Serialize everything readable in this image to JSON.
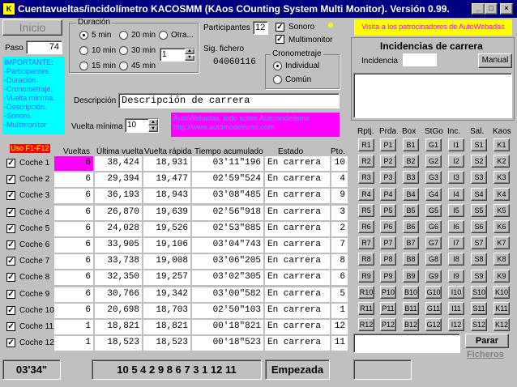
{
  "window": {
    "title": "Cuentavueltas/incidolímetro KACOSMM (KAos COunting System Multi Monitor). Versión 0.99.",
    "icon_label": "K"
  },
  "controls": {
    "minimize": "_",
    "maximize": "□",
    "close": "×"
  },
  "left": {
    "inicio": "Inicio",
    "paso_label": "Paso",
    "paso_value": "74",
    "important_text": "IMPORTANTE:\n-Participantes.\n-Duración.\n-Cronometraje.\n-Vuelta mínima.\n-Descripción.\n-Sonoro.\n-Multimonitor"
  },
  "duracion": {
    "title": "Duración",
    "options": [
      "5 min",
      "10 min",
      "15 min",
      "20 min",
      "30 min",
      "45 min",
      "Otra..."
    ],
    "selected": "5 min",
    "otra_value": "1"
  },
  "participantes": {
    "label": "Participantes",
    "value": "12"
  },
  "sig_fichero": {
    "label": "Sig. fichero",
    "value": "04060116"
  },
  "sonoro": {
    "label": "Sonoro",
    "checked": true
  },
  "multimonitor": {
    "label": "Multimonitor",
    "checked": true
  },
  "cronometraje": {
    "title": "Cronometraje",
    "options": [
      "Individual",
      "Común"
    ],
    "selected": "Individual"
  },
  "descripcion": {
    "label": "Descripción",
    "value": "Descripción de carrera"
  },
  "vuelta_minima": {
    "label": "Vuelta mínima",
    "value": "10"
  },
  "ad": {
    "text": "AutoWebadas, todo sobre Automodelismo\nhttp://www.automodelismo.com",
    "sponsor_text": "Visita a los patrocinadores de AutoWebadas"
  },
  "table": {
    "uso_label": "Uso F1-F12",
    "headers": [
      "Vueltas",
      "Última vuelta",
      "Vuelta rápida",
      "Tiempo acumulado",
      "Estado",
      "Pto."
    ],
    "rows": [
      {
        "name": "Coche 1",
        "vueltas": "6",
        "ultima": "38,424",
        "rapida": "18,931",
        "tiempo": "03'11\"196",
        "estado": "En carrera",
        "pto": "10",
        "highlight": true
      },
      {
        "name": "Coche 2",
        "vueltas": "6",
        "ultima": "29,394",
        "rapida": "19,477",
        "tiempo": "02'59\"524",
        "estado": "En carrera",
        "pto": "4",
        "highlight": false
      },
      {
        "name": "Coche 3",
        "vueltas": "6",
        "ultima": "36,193",
        "rapida": "18,943",
        "tiempo": "03'08\"485",
        "estado": "En carrera",
        "pto": "9",
        "highlight": false
      },
      {
        "name": "Coche 4",
        "vueltas": "6",
        "ultima": "26,870",
        "rapida": "19,639",
        "tiempo": "02'56\"918",
        "estado": "En carrera",
        "pto": "3",
        "highlight": false
      },
      {
        "name": "Coche 5",
        "vueltas": "6",
        "ultima": "24,028",
        "rapida": "19,526",
        "tiempo": "02'53\"885",
        "estado": "En carrera",
        "pto": "2",
        "highlight": false
      },
      {
        "name": "Coche 6",
        "vueltas": "6",
        "ultima": "33,905",
        "rapida": "19,106",
        "tiempo": "03'04\"743",
        "estado": "En carrera",
        "pto": "7",
        "highlight": false
      },
      {
        "name": "Coche 7",
        "vueltas": "6",
        "ultima": "33,738",
        "rapida": "19,008",
        "tiempo": "03'06\"205",
        "estado": "En carrera",
        "pto": "8",
        "highlight": false
      },
      {
        "name": "Coche 8",
        "vueltas": "6",
        "ultima": "32,350",
        "rapida": "19,257",
        "tiempo": "03'02\"305",
        "estado": "En carrera",
        "pto": "6",
        "highlight": false
      },
      {
        "name": "Coche 9",
        "vueltas": "6",
        "ultima": "30,766",
        "rapida": "19,342",
        "tiempo": "03'00\"582",
        "estado": "En carrera",
        "pto": "5",
        "highlight": false
      },
      {
        "name": "Coche 10",
        "vueltas": "6",
        "ultima": "20,698",
        "rapida": "18,703",
        "tiempo": "02'50\"103",
        "estado": "En carrera",
        "pto": "1",
        "highlight": false
      },
      {
        "name": "Coche 11",
        "vueltas": "1",
        "ultima": "18,821",
        "rapida": "18,821",
        "tiempo": "00'18\"821",
        "estado": "En carrera",
        "pto": "12",
        "highlight": false
      },
      {
        "name": "Coche 12",
        "vueltas": "1",
        "ultima": "18,523",
        "rapida": "18,523",
        "tiempo": "00'18\"523",
        "estado": "En carrera",
        "pto": "11",
        "highlight": false
      }
    ]
  },
  "footer": {
    "elapsed": "03'34\"",
    "order": "10 5 4 2 9 8 6 7 3 1 12 11",
    "status": "Empezada"
  },
  "right": {
    "incidencias_title": "Incidencias de carrera",
    "incidencia_label": "Incidencia",
    "manual": "Manual",
    "grid_headers": [
      "Rptj.",
      "Prda.",
      "Box",
      "StGo",
      "Inc.",
      "Sal.",
      "Kaos"
    ],
    "grid_prefixes": [
      "R",
      "P",
      "B",
      "G",
      "I",
      "S",
      "K"
    ],
    "parar": "Parar",
    "ficheros": "Ficheros"
  },
  "colors": {
    "highlight": "#ff00ff",
    "cyan": "#00ffff",
    "yellow": "#ffff00",
    "red": "#ff0000",
    "title": "#000080"
  }
}
